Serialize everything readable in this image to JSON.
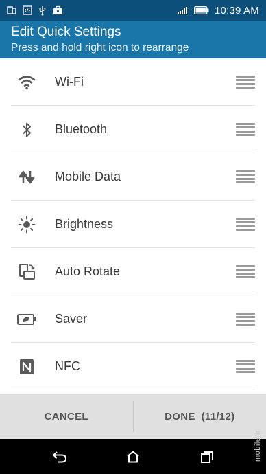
{
  "status_bar": {
    "time": "10:39 AM",
    "left_icons": [
      "notification-icon",
      "code-icon",
      "usb-icon",
      "briefcase-icon"
    ],
    "right_icons": [
      "signal-icon",
      "battery-icon"
    ]
  },
  "header": {
    "title": "Edit Quick Settings",
    "subtitle": "Press and hold right icon to rearrange",
    "color": "#1a76a8"
  },
  "items": [
    {
      "label": "Wi-Fi",
      "icon": "wifi-icon"
    },
    {
      "label": "Bluetooth",
      "icon": "bluetooth-icon"
    },
    {
      "label": "Mobile Data",
      "icon": "mobile-data-icon"
    },
    {
      "label": "Brightness",
      "icon": "brightness-icon"
    },
    {
      "label": "Auto Rotate",
      "icon": "auto-rotate-icon"
    },
    {
      "label": "Saver",
      "icon": "battery-saver-icon"
    },
    {
      "label": "NFC",
      "icon": "nfc-icon"
    }
  ],
  "footer": {
    "cancel_label": "CANCEL",
    "done_label": "DONE  (11/12)"
  },
  "nav_bar": {
    "icons": [
      "back-icon",
      "home-icon",
      "recents-icon"
    ]
  },
  "watermark": "mobile.ir"
}
